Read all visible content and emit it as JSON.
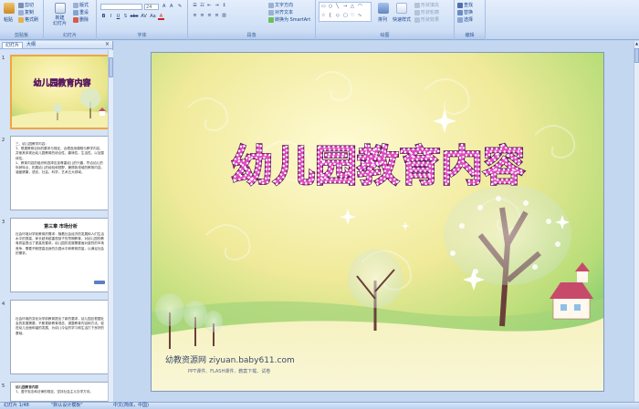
{
  "ribbon": {
    "clipboard": {
      "paste": "粘贴",
      "cut": "剪切",
      "copy": "复制",
      "format_painter": "格式刷",
      "label": "剪贴板"
    },
    "slides": {
      "new_slide": "新建\n幻灯片",
      "layout": "版式",
      "reset": "重设",
      "delete": "删除",
      "label": "幻灯片"
    },
    "font": {
      "font_size": "24",
      "label": "字体",
      "buttons": [
        "B",
        "I",
        "U",
        "S",
        "abc",
        "AV",
        "Aa",
        "A"
      ]
    },
    "paragraph": {
      "text_direction": "文字方向",
      "align_text": "对齐文本",
      "smartart": "转换为 SmartArt",
      "label": "段落"
    },
    "drawing": {
      "arrange": "排列",
      "quick_styles": "快速样式",
      "shape_fill": "形状填充",
      "shape_outline": "形状轮廓",
      "shape_effects": "形状效果",
      "label": "绘图"
    },
    "editing": {
      "find": "查找",
      "replace": "替换",
      "select": "选择",
      "label": "编辑"
    }
  },
  "panel": {
    "tabs": [
      "幻灯片",
      "大纲"
    ],
    "close": "×",
    "thumb1_title": "幼儿园教育内容",
    "thumb2_num": "2",
    "thumb2_text": "三、幼儿园教学内容：\n1、根据教育目标的要求与规定，合理选用课程与教学内容，并使其体现出幼儿园教育的综合性，趣味性，生活性，以及整体性。\n2、教育内容的组织和选择应该尊重幼儿的兴趣，符合幼儿的年龄特点，拓展幼儿的经验和视野，兼顾各领域的教育内容，涵盖健康，语言，社会，科学，艺术五大领域。",
    "thumb3_num": "3",
    "thumb3_heading": "第三章 市场分析",
    "thumb3_text": "社会环境对学前教育的需求：随着社会经济的发展和人们生活水平的提高，家长越来越重视孩子的早期教育，对幼儿园的教育质量提出了更高的要求。幼儿园的发展需要面对激烈的市场竞争，需要不断提高自身的办园水平和教育质量，以满足社会的需求。",
    "thumb4_num": "4",
    "thumb4_text": "社会环境的变化对学前教育提出了新的要求，幼儿园应根据社会的发展需要，不断更新教育观念，调整教育内容和方法，促进幼儿全面和谐的发展，为幼儿今后的学习和生活打下良好的基础。",
    "thumb5_num": "5",
    "thumb5_heading": "幼儿园教育内容",
    "thumb5_text": "1、遵守宪法和法律的规定，坚持社会主义办学方向。"
  },
  "slide": {
    "title": "幼儿园教育内容",
    "website": "幼教资源网 ziyuan.baby611.com",
    "sub": "PPT课件、FLASH课件、教案下载、试卷"
  },
  "status": {
    "slide_info": "幻灯片 1/48",
    "theme": "\"默认设计模板\"",
    "lang": "中文(简体，中国)"
  },
  "colors": {
    "accent": "#15428b",
    "title_fill": "#e04abf",
    "title_stroke": "#5a1a5e"
  }
}
